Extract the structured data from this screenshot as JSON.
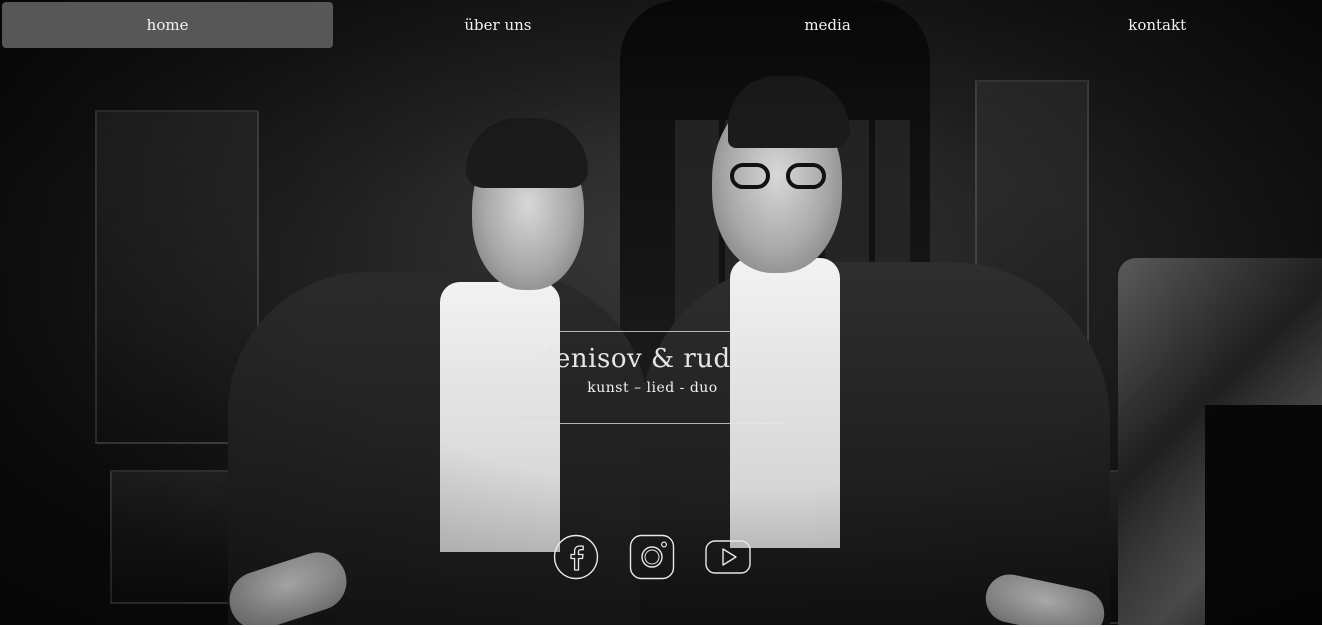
{
  "nav": {
    "items": [
      {
        "label": "home",
        "active": true
      },
      {
        "label": "über uns",
        "active": false
      },
      {
        "label": "media",
        "active": false
      },
      {
        "label": "kontakt",
        "active": false
      }
    ]
  },
  "hero": {
    "title": "denisov & rudoff",
    "subtitle": "kunst – lied - duo"
  },
  "social": {
    "icons": [
      "facebook-icon",
      "instagram-icon",
      "youtube-icon"
    ]
  },
  "colors": {
    "nav_active_bg": "#575757",
    "nav_text": "#f2f2f2",
    "title_text": "#e6e6e6"
  }
}
